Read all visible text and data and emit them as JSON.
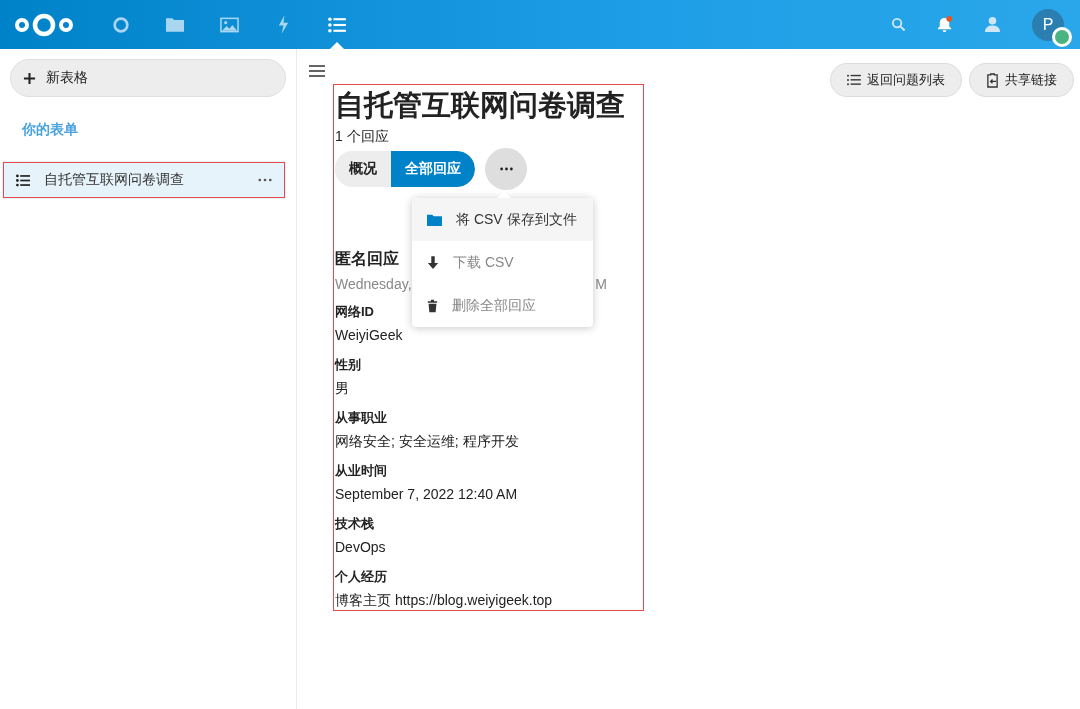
{
  "header": {
    "apps": [
      {
        "kind": "dashboard",
        "selected": false
      },
      {
        "kind": "files",
        "selected": false
      },
      {
        "kind": "photos",
        "selected": false
      },
      {
        "kind": "activity",
        "selected": false
      },
      {
        "kind": "forms",
        "selected": true
      }
    ],
    "notifications_unread": true,
    "avatar": {
      "initial": "P",
      "online": true
    }
  },
  "sidebar": {
    "new_button": "新表格",
    "section_title": "你的表单",
    "items": [
      {
        "title": "自托管互联网问卷调查",
        "selected": true,
        "annotated": true
      }
    ]
  },
  "toolbar": {
    "buttons": [
      {
        "kind": "list",
        "label": "返回问题列表"
      },
      {
        "kind": "share",
        "label": "共享链接"
      }
    ]
  },
  "form": {
    "annotated": true,
    "title": "自托管互联网问卷调查",
    "response_count": "1 个回应",
    "tabs": [
      {
        "label": "概况",
        "selected": false
      },
      {
        "label": "全部回应",
        "selected": true
      }
    ],
    "menu": {
      "items": [
        {
          "kind": "folder",
          "label": "将 CSV 保存到文件",
          "selected": true
        },
        {
          "kind": "download",
          "label": "下载 CSV",
          "selected": false
        },
        {
          "kind": "delete",
          "label": "删除全部回应",
          "selected": false
        }
      ]
    },
    "response": {
      "title": "匿名回应",
      "date_start": "Wednesday,",
      "date_end": "M",
      "answers": [
        {
          "question": "网络ID",
          "answer": "WeiyiGeek"
        },
        {
          "question": "性别",
          "answer": "男"
        },
        {
          "question": "从事职业",
          "answer": "网络安全; 安全运维; 程序开发"
        },
        {
          "question": "从业时间",
          "answer": "September 7, 2022 12:40 AM"
        },
        {
          "question": "技术栈",
          "answer": "DevOps"
        },
        {
          "question": "个人经历",
          "answer": "博客主页 https://blog.weiyigeek.top"
        }
      ]
    }
  }
}
